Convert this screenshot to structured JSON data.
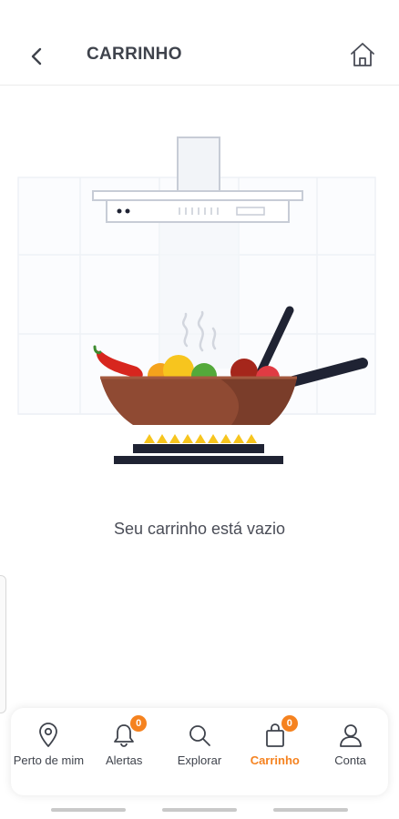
{
  "header": {
    "title": "CARRINHO",
    "back_icon": "chevron-left-icon",
    "home_icon": "home-icon"
  },
  "main": {
    "empty_message": "Seu carrinho está vazio",
    "illustration": "empty-cart-cooking-pan-illustration"
  },
  "bottom_nav": {
    "accent_color": "#f5821f",
    "items": [
      {
        "label": "Perto de mim",
        "icon": "location-pin-icon",
        "badge": null,
        "active": false
      },
      {
        "label": "Alertas",
        "icon": "bell-icon",
        "badge": "0",
        "active": false
      },
      {
        "label": "Explorar",
        "icon": "search-icon",
        "badge": null,
        "active": false
      },
      {
        "label": "Carrinho",
        "icon": "shopping-bag-icon",
        "badge": "0",
        "active": true
      },
      {
        "label": "Conta",
        "icon": "user-icon",
        "badge": null,
        "active": false
      }
    ]
  }
}
